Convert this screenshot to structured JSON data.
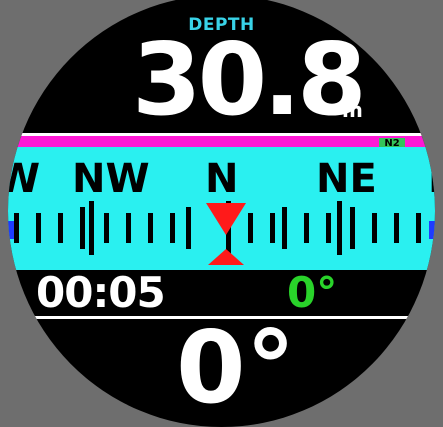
{
  "depth": {
    "label": "DEPTH",
    "value": "30.8",
    "unit": "m"
  },
  "n2": {
    "label": "N2"
  },
  "compass": {
    "cardinals": [
      "W",
      "NW",
      "N",
      "NE",
      "E"
    ]
  },
  "dive_time": "00:05",
  "bearing": "0°",
  "heading": "0°",
  "colors": {
    "accent": "#2af0f0",
    "n2_bar": "#ff19d6",
    "n2_tag": "#34c45a",
    "bearing": "#29d32a",
    "pointer": "#ff1a1a",
    "edge_marker": "#1e3cff"
  }
}
